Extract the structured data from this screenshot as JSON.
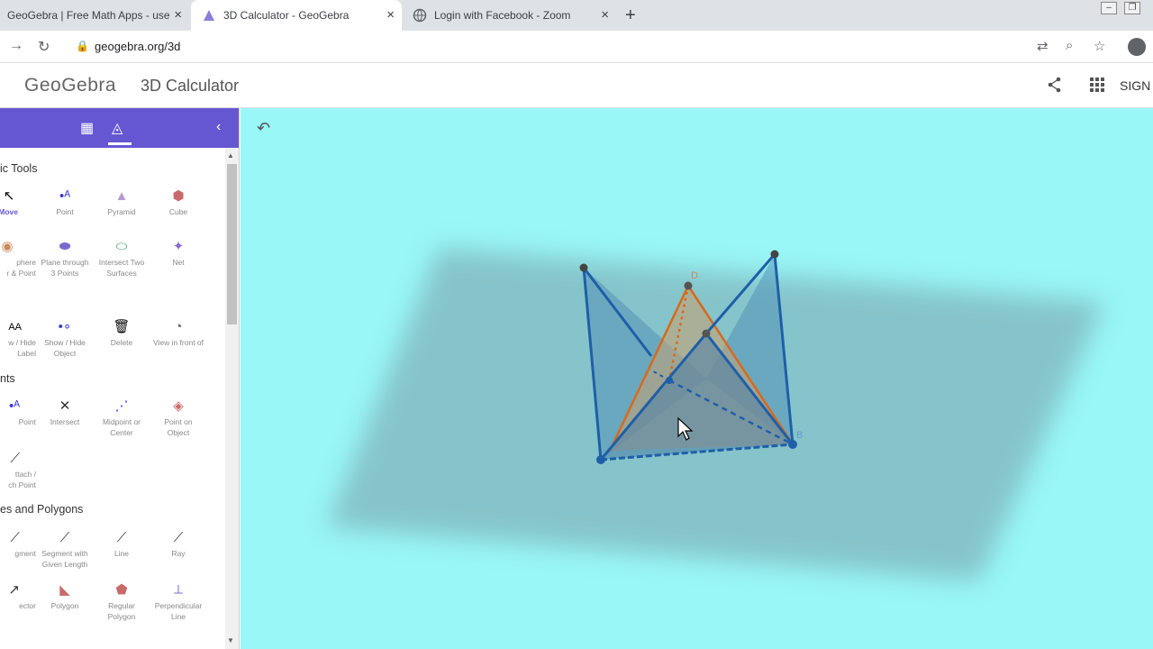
{
  "browser": {
    "tabs": [
      {
        "title": "GeoGebra | Free Math Apps - use",
        "active": false
      },
      {
        "title": "3D Calculator - GeoGebra",
        "active": true
      },
      {
        "title": "Login with Facebook - Zoom",
        "active": false
      }
    ],
    "new_tab": "+",
    "close": "×",
    "url": "geogebra.org/3d"
  },
  "app": {
    "logo": "GeoGebra",
    "title": "3D Calculator",
    "sign_in": "SIGN I"
  },
  "tools_panel": {
    "sections": [
      {
        "title": "ic Tools"
      },
      {
        "title": "nts"
      },
      {
        "title": "es and Polygons"
      }
    ],
    "tools": [
      {
        "label": "Move",
        "icon": "↖"
      },
      {
        "label": "Point",
        "icon": "•ᴬ"
      },
      {
        "label": "Pyramid",
        "icon": "▲"
      },
      {
        "label": "Cube",
        "icon": "⬢"
      },
      {
        "label": "phere",
        "label2": "r & Point",
        "icon": "◉"
      },
      {
        "label": "Plane through",
        "label2": "3 Points",
        "icon": "⬬"
      },
      {
        "label": "Intersect Two",
        "label2": "Surfaces",
        "icon": "⬭"
      },
      {
        "label": "Net",
        "icon": "✦"
      },
      {
        "label": "w / Hide",
        "label2": "Label",
        "icon": "AA"
      },
      {
        "label": "Show / Hide",
        "label2": "Object",
        "icon": "•∘"
      },
      {
        "label": "Delete",
        "icon": "🗑"
      },
      {
        "label": "View in front of",
        "icon": "◔"
      },
      {
        "label": "Point",
        "icon": "•ᴬ"
      },
      {
        "label": "Intersect",
        "icon": "✕"
      },
      {
        "label": "Midpoint or",
        "label2": "Center",
        "icon": "⋰"
      },
      {
        "label": "Point on",
        "label2": "Object",
        "icon": "◈"
      },
      {
        "label": "ttach /",
        "label2": "ch Point",
        "icon": "⟋"
      },
      {
        "label": "gment",
        "icon": "⟋"
      },
      {
        "label": "Segment with",
        "label2": "Given Length",
        "icon": "⟋"
      },
      {
        "label": "Line",
        "icon": "⟋"
      },
      {
        "label": "Ray",
        "icon": "⟋"
      },
      {
        "label": "ector",
        "icon": "↗"
      },
      {
        "label": "Polygon",
        "icon": "◣"
      },
      {
        "label": "Regular",
        "label2": "Polygon",
        "icon": "⬟"
      },
      {
        "label": "Perpendicular",
        "label2": "Line",
        "icon": "⟂"
      }
    ]
  },
  "graphics": {
    "points": {
      "D": "D",
      "B": "B"
    },
    "colors": {
      "background": "#99f7f7",
      "edge_blue": "#1f5fa8",
      "edge_orange": "#d66a1e",
      "accent": "#6557d2"
    }
  }
}
